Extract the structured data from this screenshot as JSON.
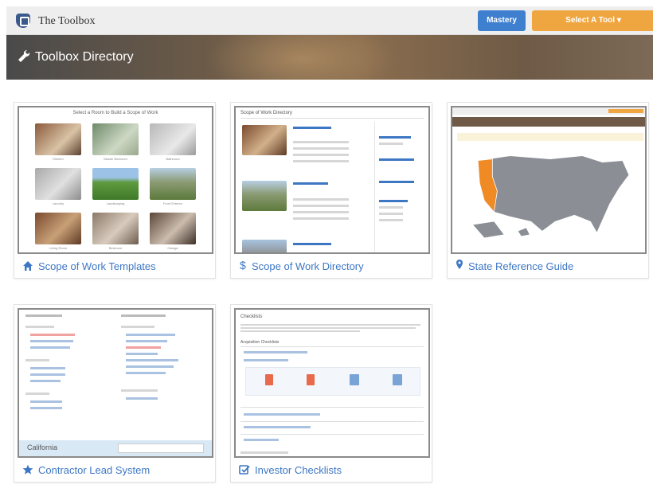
{
  "app": {
    "title": "The Toolbox"
  },
  "header": {
    "mastery_label": "Mastery",
    "select_label": "Select A Tool"
  },
  "banner": {
    "title": "Toolbox Directory"
  },
  "cards": [
    {
      "label": "Scope of Work Templates",
      "icon": "home-icon"
    },
    {
      "label": "Scope of Work Directory",
      "icon": "dollar-icon"
    },
    {
      "label": "State Reference Guide",
      "icon": "map-marker-icon"
    },
    {
      "label": "Contractor Lead System",
      "icon": "star-icon"
    },
    {
      "label": "Investor Checklists",
      "icon": "checklist-icon"
    }
  ],
  "previews": {
    "templates": {
      "title": "Select a Room to Build a Scope of Work",
      "rooms": [
        "Kitchen",
        "Master Bedroom",
        "Bathroom",
        "Laundry",
        "Landscaping",
        "Front Exterior",
        "Living Room",
        "Bedroom",
        "Garage"
      ]
    },
    "directory": {
      "title": "Scope of Work Directory"
    },
    "contractor": {
      "select_value": "California"
    },
    "checklists": {
      "title": "Checklists",
      "section": "Acquisition Checklists"
    }
  },
  "colors": {
    "accent_blue": "#3d77c4",
    "mastery_blue": "#3f7fd0",
    "select_orange": "#f0a640"
  }
}
